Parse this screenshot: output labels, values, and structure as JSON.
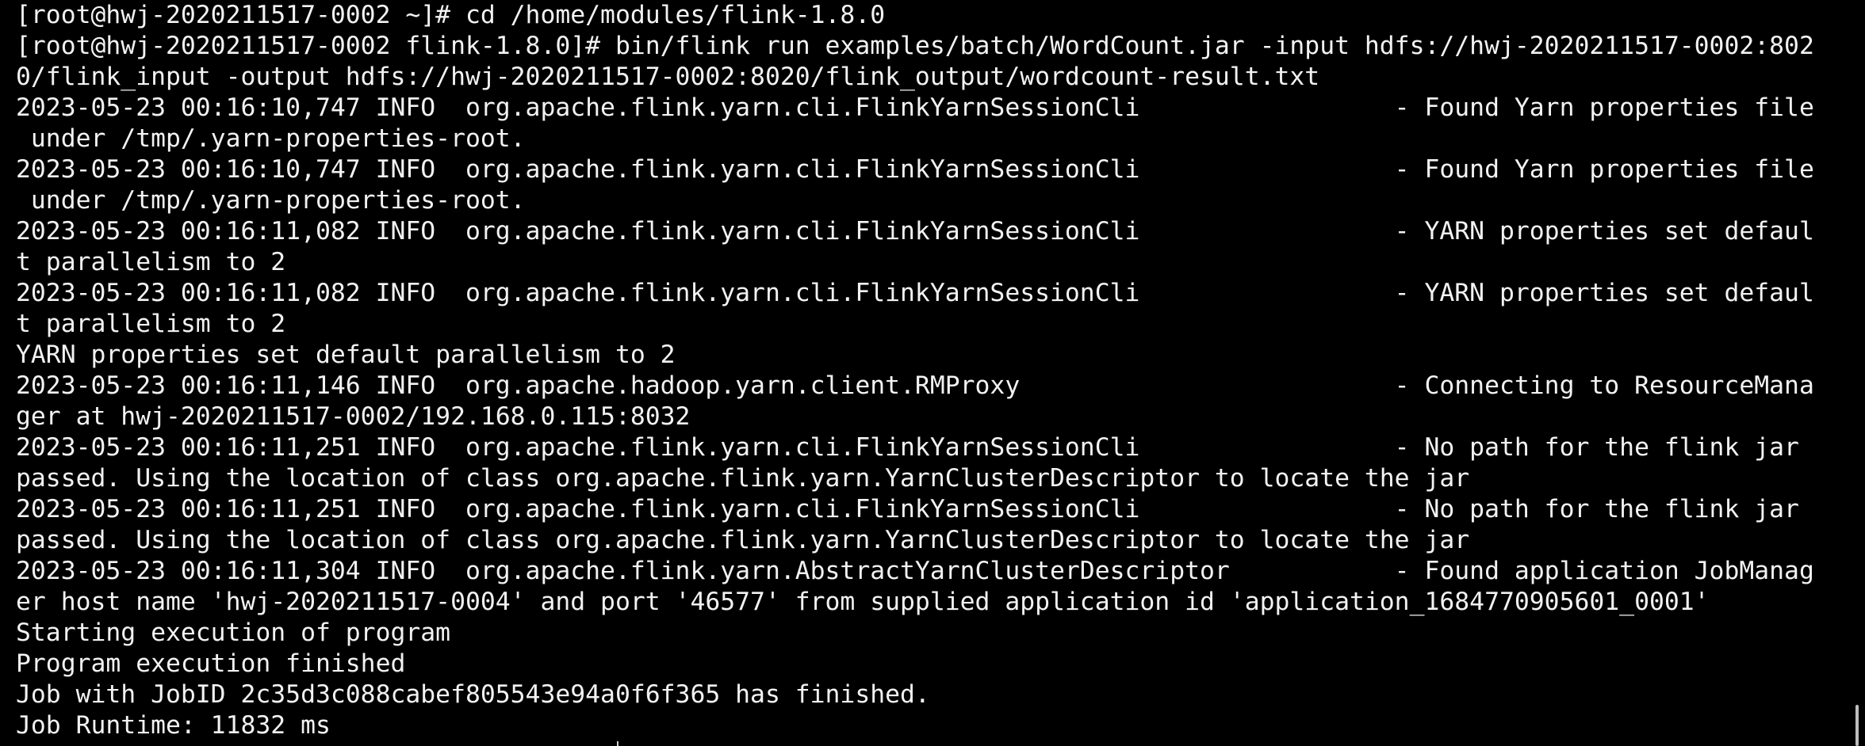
{
  "terminal": {
    "lines": [
      "[root@hwj-2020211517-0002 ~]# cd /home/modules/flink-1.8.0",
      "[root@hwj-2020211517-0002 flink-1.8.0]# bin/flink run examples/batch/WordCount.jar -input hdfs://hwj-2020211517-0002:802",
      "0/flink_input -output hdfs://hwj-2020211517-0002:8020/flink_output/wordcount-result.txt",
      "2023-05-23 00:16:10,747 INFO  org.apache.flink.yarn.cli.FlinkYarnSessionCli                 - Found Yarn properties file",
      " under /tmp/.yarn-properties-root.",
      "2023-05-23 00:16:10,747 INFO  org.apache.flink.yarn.cli.FlinkYarnSessionCli                 - Found Yarn properties file",
      " under /tmp/.yarn-properties-root.",
      "2023-05-23 00:16:11,082 INFO  org.apache.flink.yarn.cli.FlinkYarnSessionCli                 - YARN properties set defaul",
      "t parallelism to 2",
      "2023-05-23 00:16:11,082 INFO  org.apache.flink.yarn.cli.FlinkYarnSessionCli                 - YARN properties set defaul",
      "t parallelism to 2",
      "YARN properties set default parallelism to 2",
      "2023-05-23 00:16:11,146 INFO  org.apache.hadoop.yarn.client.RMProxy                         - Connecting to ResourceMana",
      "ger at hwj-2020211517-0002/192.168.0.115:8032",
      "2023-05-23 00:16:11,251 INFO  org.apache.flink.yarn.cli.FlinkYarnSessionCli                 - No path for the flink jar",
      "passed. Using the location of class org.apache.flink.yarn.YarnClusterDescriptor to locate the jar",
      "2023-05-23 00:16:11,251 INFO  org.apache.flink.yarn.cli.FlinkYarnSessionCli                 - No path for the flink jar",
      "passed. Using the location of class org.apache.flink.yarn.YarnClusterDescriptor to locate the jar",
      "2023-05-23 00:16:11,304 INFO  org.apache.flink.yarn.AbstractYarnClusterDescriptor           - Found application JobManag",
      "er host name 'hwj-2020211517-0004' and port '46577' from supplied application id 'application_1684770905601_0001'",
      "Starting execution of program",
      "Program execution finished",
      "Job with JobID 2c35d3c088cabef805543e94a0f6f365 has finished.",
      "Job Runtime: 11832 ms"
    ]
  },
  "colors": {
    "background": "#000000",
    "foreground": "#f2f2f2"
  }
}
